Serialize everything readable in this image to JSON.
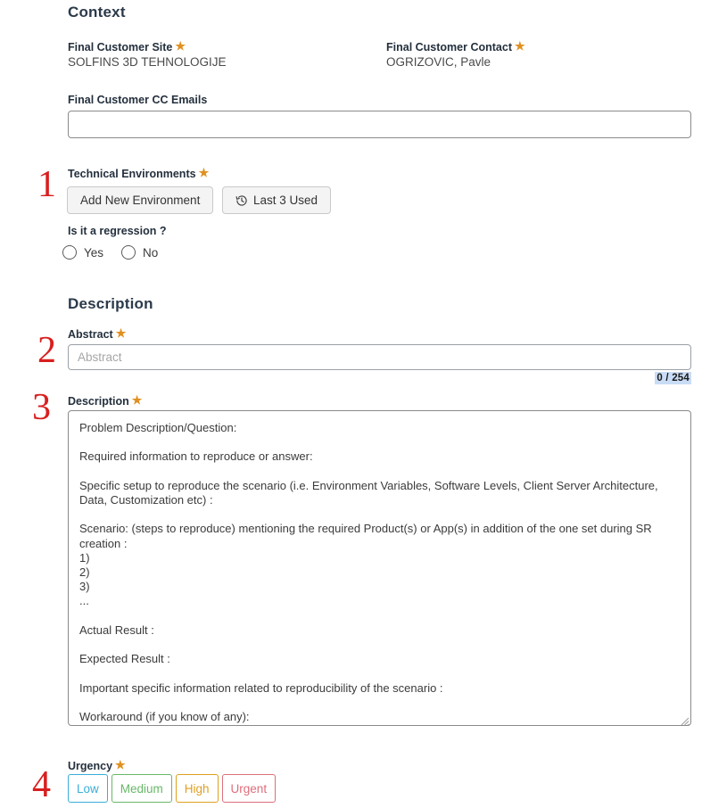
{
  "sections": {
    "context_title": "Context",
    "description_title": "Description"
  },
  "annotations": {
    "step1": "1",
    "step2": "2",
    "step3": "3",
    "step4": "4"
  },
  "required_marker": "★",
  "context": {
    "final_customer_site": {
      "label": "Final Customer Site",
      "value": "SOLFINS 3D TEHNOLOGIJE",
      "required": true
    },
    "final_customer_contact": {
      "label": "Final Customer Contact",
      "value": "OGRIZOVIC, Pavle",
      "required": true
    },
    "final_customer_cc_emails": {
      "label": "Final Customer CC Emails",
      "value": "",
      "placeholder": "",
      "required": false
    },
    "technical_environments": {
      "label": "Technical Environments",
      "required": true,
      "add_button_label": "Add New Environment",
      "last_used_button_label": "Last 3 Used",
      "last_used_icon": "history-clock-icon"
    },
    "regression": {
      "label": "Is it a regression ?",
      "required": false,
      "options": [
        {
          "label": "Yes",
          "selected": false
        },
        {
          "label": "No",
          "selected": false
        }
      ]
    }
  },
  "description": {
    "abstract": {
      "label": "Abstract",
      "required": true,
      "value": "",
      "placeholder": "Abstract",
      "char_counter": "0 / 254"
    },
    "description_field": {
      "label": "Description",
      "required": true,
      "value": "Problem Description/Question:\n\nRequired information to reproduce or answer:\n\nSpecific setup to reproduce the scenario (i.e. Environment Variables, Software Levels, Client Server Architecture, Data, Customization etc) :\n\nScenario: (steps to reproduce) mentioning the required Product(s) or App(s) in addition of the one set during SR creation :\n1)\n2)\n3)\n...\n\nActual Result :\n\nExpected Result :\n\nImportant specific information related to reproducibility of the scenario :\n\nWorkaround (if you know of any):"
    },
    "urgency": {
      "label": "Urgency",
      "required": true,
      "options": [
        {
          "label": "Low",
          "color": "#3aaed8",
          "selected": false
        },
        {
          "label": "Medium",
          "color": "#68b868",
          "selected": false
        },
        {
          "label": "High",
          "color": "#e0a020",
          "selected": false
        },
        {
          "label": "Urgent",
          "color": "#dd6f7c",
          "selected": false
        }
      ]
    }
  },
  "colors": {
    "heading": "#2b3a4a",
    "required_star": "#e0901f",
    "annotation_red": "#d81f1f",
    "counter_highlight": "#c9dcf5"
  }
}
